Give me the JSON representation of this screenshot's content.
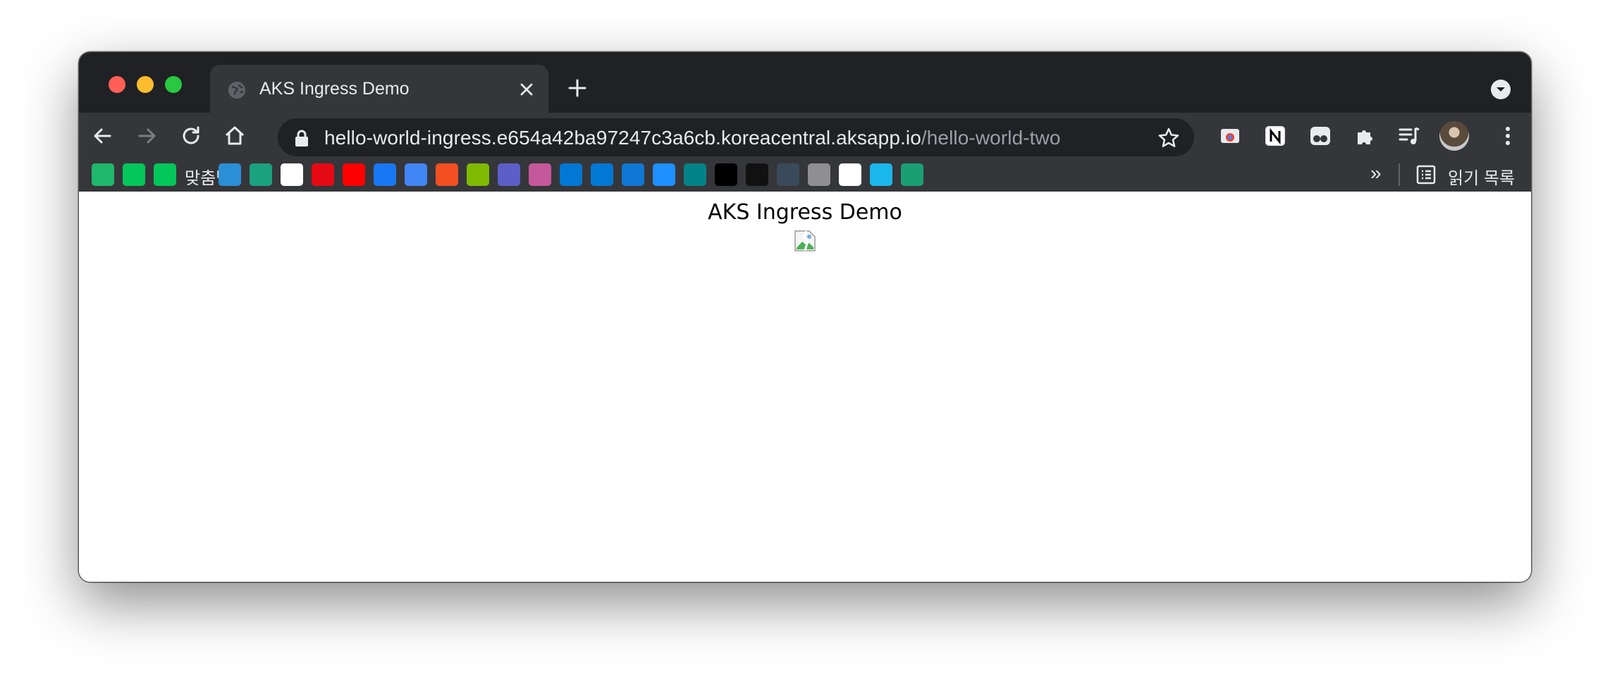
{
  "tab": {
    "title": "AKS Ingress Demo"
  },
  "address": {
    "host": "hello-world-ingress.e654a42ba97247c3a6cb.koreacentral.aksapp.io",
    "path": "/hello-world-two"
  },
  "bookmarks": [
    {
      "icon": "dooray-icon",
      "color": "#1fb86a"
    },
    {
      "icon": "naver-icon",
      "color": "#03c75a"
    },
    {
      "icon": "naver-icon",
      "color": "#03c75a",
      "label": "맞춤법"
    },
    {
      "icon": "edge-icon",
      "color": "#2a8fd6"
    },
    {
      "icon": "circle-logo-icon",
      "color": "#1aa17f"
    },
    {
      "icon": "naver-map-icon",
      "color": "#ffffff"
    },
    {
      "icon": "netflix-icon",
      "color": "#e50914"
    },
    {
      "icon": "youtube-icon",
      "color": "#ff0000"
    },
    {
      "icon": "facebook-icon",
      "color": "#1877f2"
    },
    {
      "icon": "google-translate-icon",
      "color": "#4285f4"
    },
    {
      "icon": "microsoft-icon",
      "color": "#f25022"
    },
    {
      "icon": "microsoft-icon",
      "color": "#7fba00"
    },
    {
      "icon": "teams-icon",
      "color": "#5b5fc7"
    },
    {
      "icon": "power-apps-icon",
      "color": "#c5589a"
    },
    {
      "icon": "azure-icon",
      "color": "#0078d4"
    },
    {
      "icon": "azure-devops-icon",
      "color": "#0078d4"
    },
    {
      "icon": "onedrive-icon",
      "color": "#0f78d4"
    },
    {
      "icon": "target-icon",
      "color": "#1e90ff"
    },
    {
      "icon": "sharepoint-icon",
      "color": "#038387"
    },
    {
      "icon": "medium-icon",
      "color": "#000000"
    },
    {
      "icon": "mail-icon",
      "color": "#111111"
    },
    {
      "icon": "cube-icon",
      "color": "#3a4a5a"
    },
    {
      "icon": "apple-icon",
      "color": "#8e8e93"
    },
    {
      "icon": "github-icon",
      "color": "#ffffff"
    },
    {
      "icon": "vimeo-icon",
      "color": "#1ab7ea"
    },
    {
      "icon": "vuetify-icon",
      "color": "#1a9f73"
    }
  ],
  "bookmarks_more": "»",
  "reading_list_label": "읽기 목록",
  "page": {
    "heading": "AKS Ingress Demo"
  }
}
